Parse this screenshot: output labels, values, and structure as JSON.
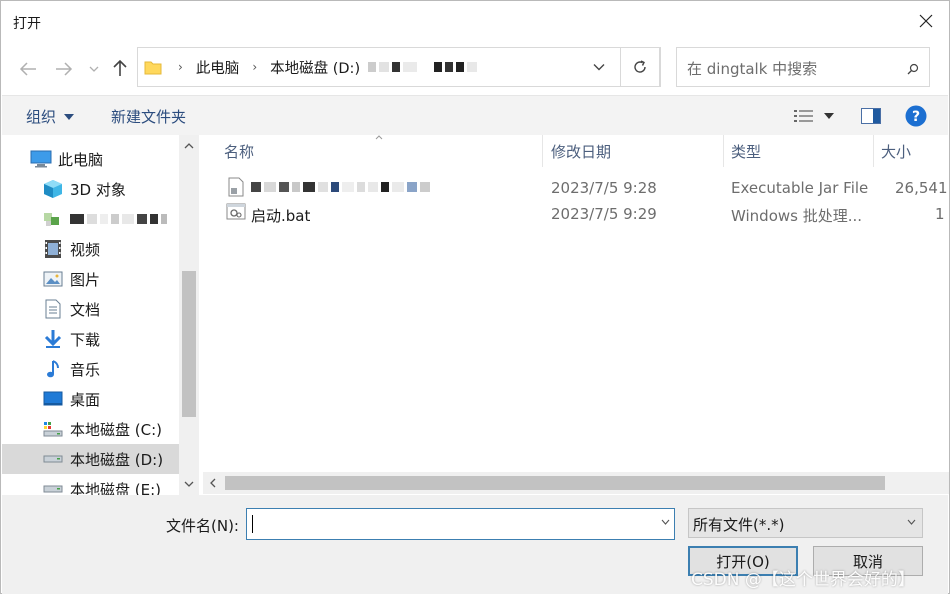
{
  "window": {
    "title": "打开"
  },
  "address": {
    "crumbs": [
      "此电脑",
      "本地磁盘 (D:)"
    ]
  },
  "search": {
    "placeholder": "在 dingtalk 中搜索"
  },
  "toolbar": {
    "organize": "组织",
    "new_folder": "新建文件夹"
  },
  "sidebar": {
    "items": [
      {
        "label": "此电脑",
        "icon": "computer-icon"
      },
      {
        "label": "3D 对象",
        "icon": "cube-icon"
      },
      {
        "label": "",
        "icon": "network-icon"
      },
      {
        "label": "视频",
        "icon": "video-icon"
      },
      {
        "label": "图片",
        "icon": "picture-icon"
      },
      {
        "label": "文档",
        "icon": "document-icon"
      },
      {
        "label": "下载",
        "icon": "download-icon"
      },
      {
        "label": "音乐",
        "icon": "music-icon"
      },
      {
        "label": "桌面",
        "icon": "desktop-icon"
      },
      {
        "label": "本地磁盘 (C:)",
        "icon": "drive-icon"
      },
      {
        "label": "本地磁盘 (D:)",
        "icon": "drive-icon"
      },
      {
        "label": "本地磁盘 (E:)",
        "icon": "drive-icon"
      }
    ]
  },
  "filelist": {
    "columns": [
      "名称",
      "修改日期",
      "类型",
      "大小"
    ],
    "rows": [
      {
        "name": "",
        "date": "2023/7/5 9:28",
        "type": "Executable Jar File",
        "size": "26,541"
      },
      {
        "name": "启动.bat",
        "date": "2023/7/5 9:29",
        "type": "Windows 批处理...",
        "size": "1"
      }
    ]
  },
  "bottom": {
    "filename_label": "文件名(N):",
    "filename_value": "",
    "filter_value": "所有文件(*.*)",
    "open_label": "打开(O)",
    "cancel_label": "取消"
  },
  "watermark": "CSDN @【这个世界会好的】",
  "colors": {
    "accent": "#3c7fb1",
    "link": "#2b4c7e",
    "help": "#1c6fd1"
  }
}
